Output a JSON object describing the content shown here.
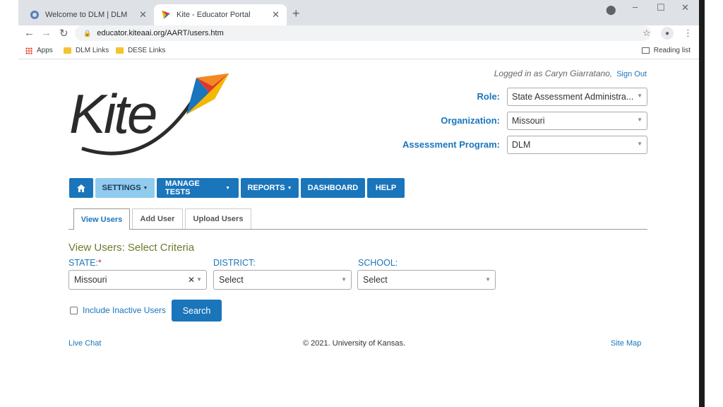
{
  "browser": {
    "tabs": [
      {
        "title": "Welcome to DLM | DLM",
        "active": false
      },
      {
        "title": "Kite - Educator Portal",
        "active": true
      }
    ],
    "url": "educator.kiteaai.org/AART/users.htm",
    "bookmarks": [
      "Apps",
      "DLM Links",
      "DESE Links"
    ],
    "reading_list": "Reading list"
  },
  "header": {
    "logo_text": "Kite",
    "logged_in_text": "Logged in as Caryn Giarratano,",
    "sign_out": "Sign Out",
    "role_label": "Role:",
    "role_value": "State Assessment Administra...",
    "organization_label": "Organization:",
    "organization_value": "Missouri",
    "program_label": "Assessment Program:",
    "program_value": "DLM"
  },
  "nav": {
    "home_icon": "home-icon",
    "items": [
      "SETTINGS",
      "MANAGE TESTS",
      "REPORTS",
      "DASHBOARD",
      "HELP"
    ]
  },
  "page_tabs": [
    "View Users",
    "Add User",
    "Upload Users"
  ],
  "criteria": {
    "title": "View Users: Select Criteria",
    "state_label": "STATE:",
    "state_required": "*",
    "state_value": "Missouri",
    "district_label": "DISTRICT:",
    "district_value": "Select",
    "school_label": "SCHOOL:",
    "school_value": "Select",
    "include_inactive": "Include Inactive Users",
    "search": "Search"
  },
  "footer": {
    "live_chat": "Live Chat",
    "copyright": "© 2021. University of Kansas.",
    "site_map": "Site Map"
  },
  "colors": {
    "brand_blue": "#1a75bb",
    "active_menu": "#91cbee",
    "criteria_title": "#6b7c2b",
    "required": "#d9232e"
  }
}
